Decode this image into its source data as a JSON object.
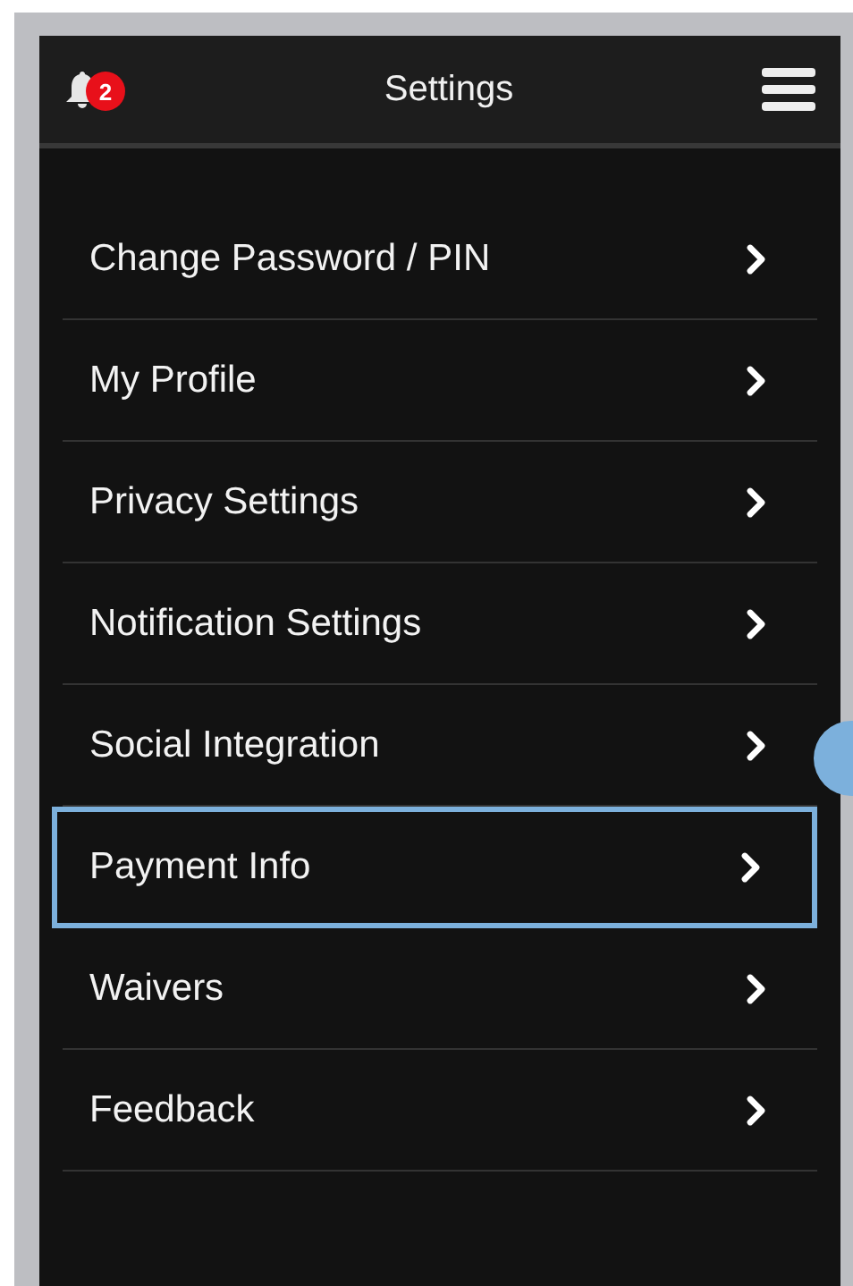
{
  "header": {
    "title": "Settings",
    "notification_count": "2"
  },
  "items": [
    {
      "label": "Change Password / PIN",
      "highlighted": false
    },
    {
      "label": "My Profile",
      "highlighted": false
    },
    {
      "label": "Privacy Settings",
      "highlighted": false
    },
    {
      "label": "Notification Settings",
      "highlighted": false
    },
    {
      "label": "Social Integration",
      "highlighted": false
    },
    {
      "label": "Payment Info",
      "highlighted": true
    },
    {
      "label": "Waivers",
      "highlighted": false
    },
    {
      "label": "Feedback",
      "highlighted": false
    }
  ]
}
